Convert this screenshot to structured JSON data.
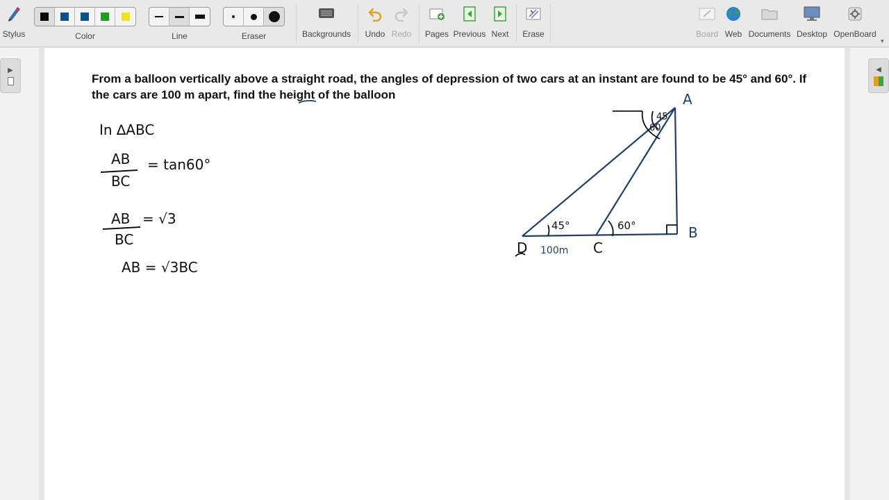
{
  "toolbar": {
    "stylus": "Stylus",
    "color": "Color",
    "line": "Line",
    "eraser": "Eraser",
    "backgrounds": "Backgrounds",
    "undo": "Undo",
    "redo": "Redo",
    "pages": "Pages",
    "previous": "Previous",
    "next": "Next",
    "erase": "Erase",
    "board": "Board",
    "web": "Web",
    "documents": "Documents",
    "desktop": "Desktop",
    "openboard": "OpenBoard"
  },
  "colors": [
    "#000000",
    "#0b4f8a",
    "#0b4f8a",
    "#1f9e1f",
    "#f2e21b"
  ],
  "ink_color": "#1b3f6e",
  "question": "From a balloon vertically above a straight road, the angles of depression of two cars at an instant are found to be 45° and 60°. If the cars are 100 m apart, find the height of the balloon",
  "handwriting": {
    "line1": "In ∆ABC",
    "frac1_num": "AB",
    "frac1_den": "BC",
    "eq1_rhs": "= tan60°",
    "frac2_num": "AB",
    "frac2_den": "BC",
    "eq2_rhs": "= √3",
    "eq3": "AB = √3BC"
  },
  "diagram": {
    "label_a": "A",
    "label_b": "B",
    "label_c": "C",
    "label_d": "D",
    "dist": "100m",
    "angle_d": "45°",
    "angle_c": "60°",
    "angle_top1": "45",
    "angle_top2": "60"
  }
}
